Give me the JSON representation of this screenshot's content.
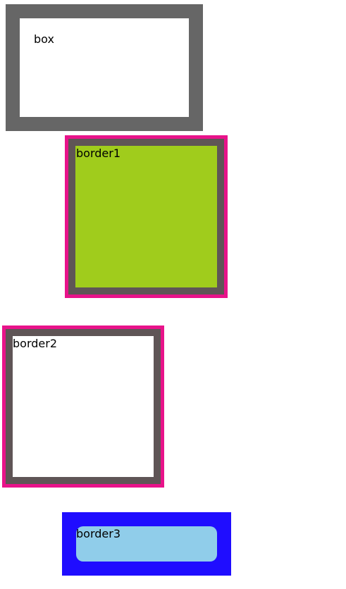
{
  "boxes": {
    "box_label": "box",
    "border1_label": "border1",
    "border2_label": "border2",
    "border3_label": "border3"
  },
  "colors": {
    "box_border": "#666666",
    "outline_pink": "#e8138a",
    "dark_border": "#5f5556",
    "green_fill": "#a0cc1c",
    "blue_outer": "#1f0dff",
    "light_blue_inner": "#90cdea"
  }
}
